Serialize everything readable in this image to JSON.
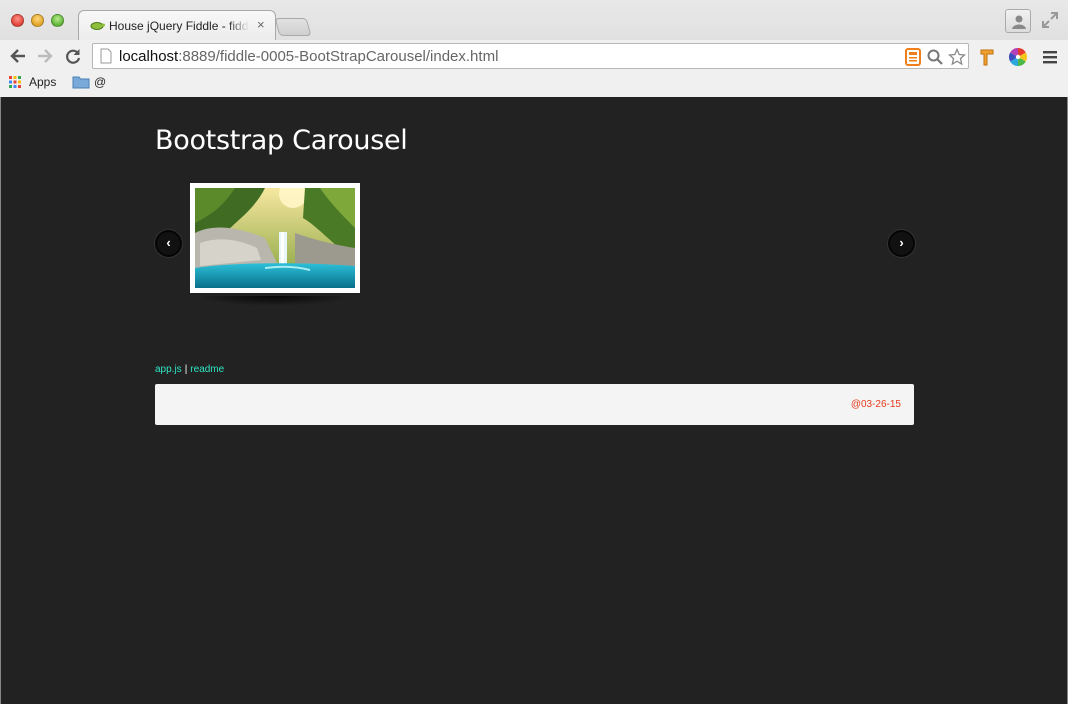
{
  "browser": {
    "tab_title": "House jQuery Fiddle - fiddle",
    "tab_close": "×",
    "url_host": "localhost",
    "url_rest": ":8889/fiddle-0005-BootStrapCarousel/index.html",
    "bookmarks": [
      {
        "label": "Apps",
        "icon": "apps-grid-icon"
      },
      {
        "label": "@",
        "icon": "folder-icon"
      }
    ]
  },
  "page": {
    "title": "Bootstrap Carousel",
    "carousel": {
      "prev_label": "‹",
      "next_label": "›"
    },
    "links": {
      "app_js": "app.js",
      "separator": "|",
      "readme": "readme"
    },
    "footer": {
      "date": "@03-26-15"
    }
  },
  "colors": {
    "page_background": "#222222",
    "link": "#2ee6c4",
    "footer_date": "#e53a1c",
    "footer_background": "#f4f4f4"
  }
}
